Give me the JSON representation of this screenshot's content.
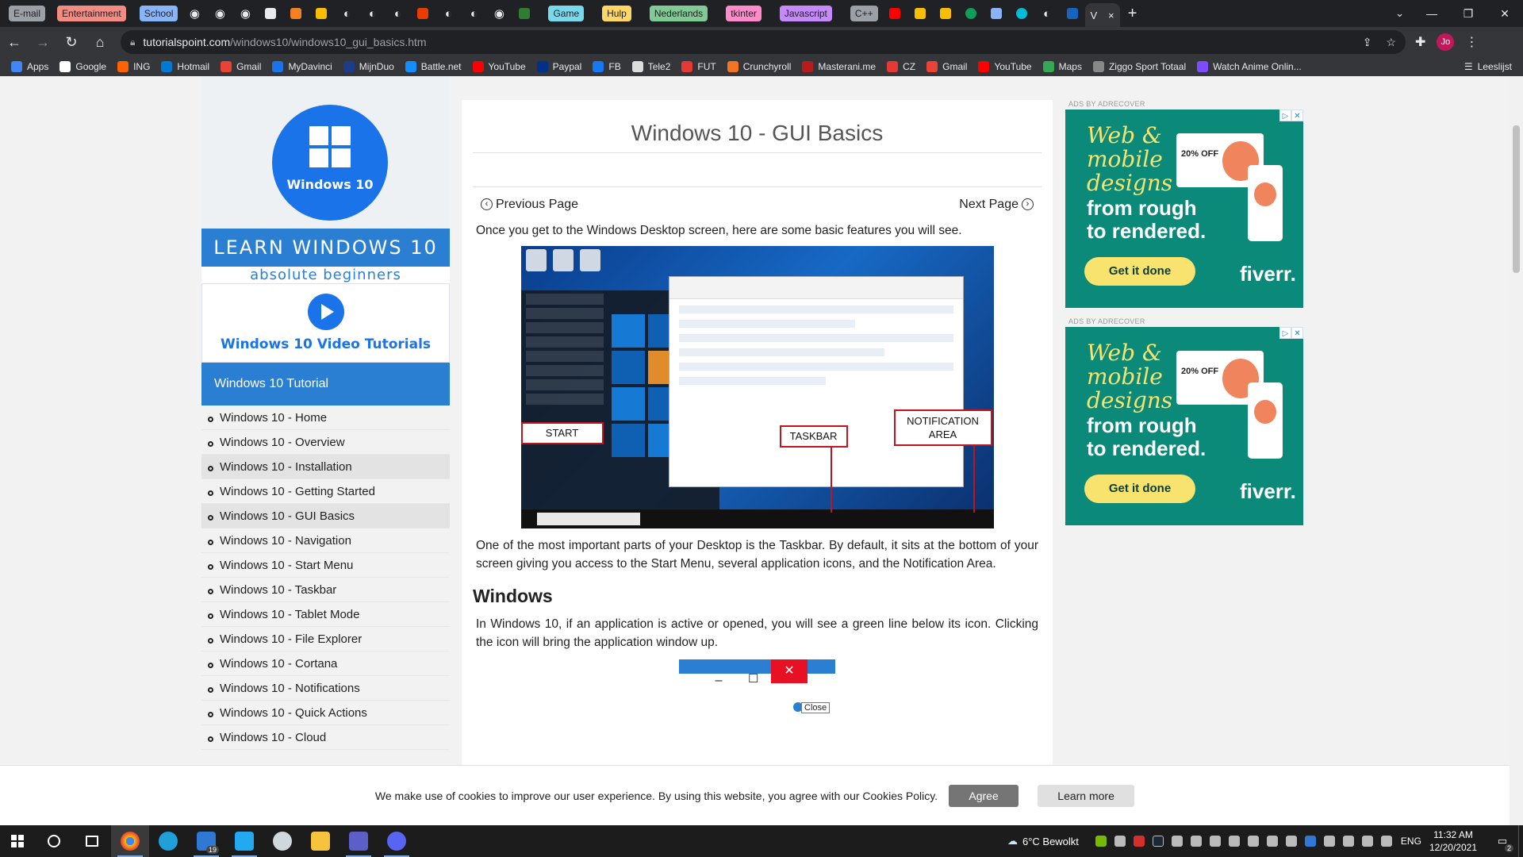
{
  "browser": {
    "tab_groups": [
      {
        "label": "E-mail",
        "bg": "#9aa0a6",
        "fg": "#202124"
      },
      {
        "label": "Entertainment",
        "bg": "#f28b82",
        "fg": "#202124"
      },
      {
        "label": "School",
        "bg": "#8ab4f8",
        "fg": "#202124"
      },
      {
        "label": "Game",
        "bg": "#78d9ec",
        "fg": "#202124"
      },
      {
        "label": "Hulp",
        "bg": "#fdd663",
        "fg": "#202124"
      },
      {
        "label": "Nederlands",
        "bg": "#81c995",
        "fg": "#202124"
      },
      {
        "label": "tkinter",
        "bg": "#ff8bcb",
        "fg": "#202124"
      },
      {
        "label": "Javascript",
        "bg": "#c58af9",
        "fg": "#202124"
      },
      {
        "label": "C++",
        "bg": "#9aa0a6",
        "fg": "#202124"
      }
    ],
    "active_tab_title": "V",
    "close_icon": "×",
    "new_tab_icon": "+",
    "url_domain": "tutorialspoint.com",
    "url_path": "/windows10/windows10_gui_basics.htm",
    "profile_initials": "Jo"
  },
  "bookmarks": {
    "items": [
      {
        "label": "Apps",
        "color": "#4285f4"
      },
      {
        "label": "Google",
        "color": "#ffffff"
      },
      {
        "label": "ING",
        "color": "#ff6200"
      },
      {
        "label": "Hotmail",
        "color": "#0078d4"
      },
      {
        "label": "Gmail",
        "color": "#ea4335"
      },
      {
        "label": "MyDavinci",
        "color": "#1a73e8"
      },
      {
        "label": "MijnDuo",
        "color": "#1f3c88"
      },
      {
        "label": "Battle.net",
        "color": "#148eff"
      },
      {
        "label": "YouTube",
        "color": "#ff0000"
      },
      {
        "label": "Paypal",
        "color": "#003087"
      },
      {
        "label": "FB",
        "color": "#1877f2"
      },
      {
        "label": "Tele2",
        "color": "#dddddd"
      },
      {
        "label": "FUT",
        "color": "#e53935"
      },
      {
        "label": "Crunchyroll",
        "color": "#f47521"
      },
      {
        "label": "Masterani.me",
        "color": "#b71c1c"
      },
      {
        "label": "CZ",
        "color": "#e53935"
      },
      {
        "label": "Gmail",
        "color": "#ea4335"
      },
      {
        "label": "YouTube",
        "color": "#ff0000"
      },
      {
        "label": "Maps",
        "color": "#34a853"
      },
      {
        "label": "Ziggo Sport Totaal",
        "color": "#888888"
      },
      {
        "label": "Watch Anime Onlin...",
        "color": "#7c4dff"
      }
    ],
    "reading_list": "Leeslijst"
  },
  "sidebar": {
    "logo_text": "Windows 10",
    "learn_title": "LEARN WINDOWS 10",
    "learn_subtitle": "absolute beginners",
    "video_label": "Windows 10 Video Tutorials",
    "nav_heading": "Windows 10 Tutorial",
    "items": [
      "Windows 10 - Home",
      "Windows 10 - Overview",
      "Windows 10 - Installation",
      "Windows 10 - Getting Started",
      "Windows 10 - GUI Basics",
      "Windows 10 - Navigation",
      "Windows 10 - Start Menu",
      "Windows 10 - Taskbar",
      "Windows 10 - Tablet Mode",
      "Windows 10 - File Explorer",
      "Windows 10 - Cortana",
      "Windows 10 - Notifications",
      "Windows 10 - Quick Actions",
      "Windows 10 - Cloud"
    ]
  },
  "content": {
    "title": "Windows 10 - GUI Basics",
    "prev_label": "Previous Page",
    "next_label": "Next Page",
    "intro": "Once you get to the Windows Desktop screen, here are some basic features you will see.",
    "callouts": {
      "start": "START",
      "taskbar": "TASKBAR",
      "notification_line1": "NOTIFICATION",
      "notification_line2": "AREA"
    },
    "taskbar_para": "One of the most important parts of your Desktop is the Taskbar. By default, it sits at the bottom of your screen giving you access to the Start Menu, several application icons, and the Notification Area.",
    "windows_heading": "Windows",
    "windows_para": "In Windows 10, if an application is active or opened, you will see a green line below its icon. Clicking the icon will bring the application window up.",
    "close_tooltip": "Close"
  },
  "ads": {
    "label": "ADS BY ADRECOVER",
    "headline_1": "Web &",
    "headline_2": "mobile",
    "headline_3": "designs",
    "headline_4": "from rough",
    "headline_5": "to rendered.",
    "cta": "Get it done",
    "brand": "fiverr.",
    "discount": "20% OFF"
  },
  "cookie": {
    "message": "We make use of cookies to improve our user experience. By using this website, you agree with our Cookies Policy.",
    "agree": "Agree",
    "learn_more": "Learn more"
  },
  "taskbar": {
    "weather": "6°C Bewolkt",
    "language": "ENG",
    "time": "11:32 AM",
    "date": "12/20/2021",
    "mail_badge": "19",
    "notification_badge": "2"
  }
}
